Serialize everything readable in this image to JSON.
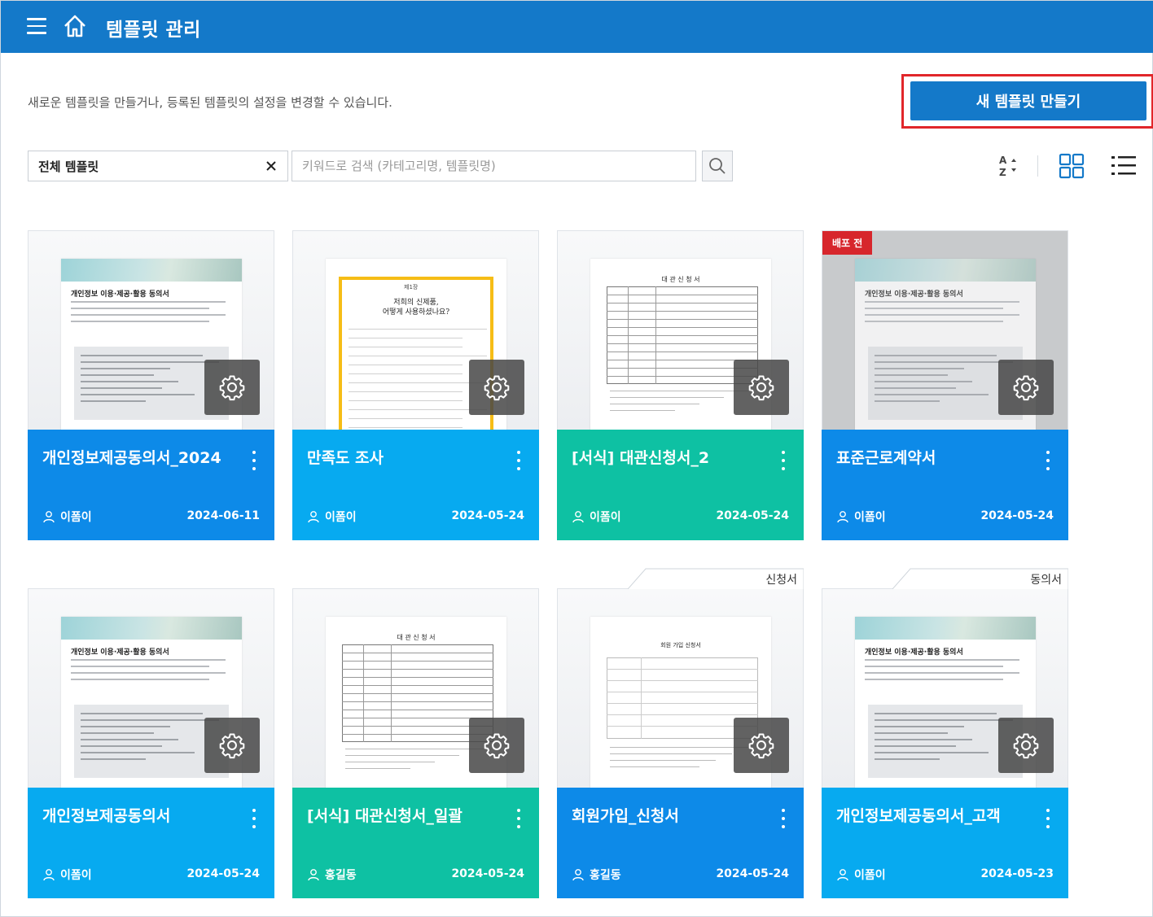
{
  "header": {
    "title": "템플릿 관리"
  },
  "description": "새로운 템플릿을 만들거나, 등록된 템플릿의 설정을 변경할 수 있습니다.",
  "new_button_label": "새 템플릿 만들기",
  "filter": {
    "selected": "전체 템플릿",
    "search_placeholder": "키워드로 검색 (카테고리명, 템플릿명)"
  },
  "colors": {
    "header": "#1479c9",
    "card_blue": "#0d8ae8",
    "card_sky": "#07aaf0",
    "card_teal": "#0ec1a3",
    "highlight": "#e1262a"
  },
  "cards": [
    {
      "title": "개인정보제공동의서_2024",
      "author": "이폼이",
      "date": "2024-06-11",
      "color": "blue",
      "thumb": "consent"
    },
    {
      "title": "만족도 조사",
      "author": "이폼이",
      "date": "2024-05-24",
      "color": "sky",
      "thumb": "survey",
      "doc_title": "저희의 신제품,",
      "doc_subtitle": "어떻게 사용하셨나요?"
    },
    {
      "title": "[서식] 대관신청서_2",
      "author": "이폼이",
      "date": "2024-05-24",
      "color": "teal",
      "thumb": "rental",
      "doc_title": "대 관 신 청 서"
    },
    {
      "title": "표준근로계약서",
      "author": "이폼이",
      "date": "2024-05-24",
      "color": "blue",
      "thumb": "consent",
      "badge": "배포 전"
    },
    {
      "title": "개인정보제공동의서",
      "author": "이폼이",
      "date": "2024-05-24",
      "color": "sky",
      "thumb": "consent"
    },
    {
      "title": "[서식] 대관신청서_일괄",
      "author": "홍길동",
      "date": "2024-05-24",
      "color": "teal",
      "thumb": "rental",
      "doc_title": "대 관 신 청 서"
    },
    {
      "title": "회원가입_신청서",
      "author": "홍길동",
      "date": "2024-05-24",
      "color": "blue",
      "thumb": "member",
      "tag": "신청서",
      "doc_title": "회원 가입 신청서"
    },
    {
      "title": "개인정보제공동의서_고객",
      "author": "이폼이",
      "date": "2024-05-23",
      "color": "sky",
      "thumb": "consent",
      "tag": "동의서"
    }
  ],
  "consent_doc_title": "개인정보 이용·제공·활용 동의서"
}
